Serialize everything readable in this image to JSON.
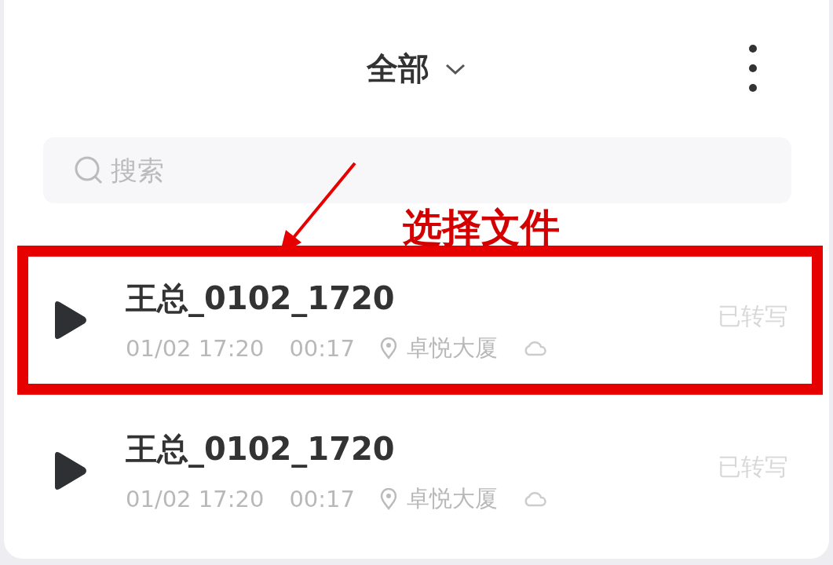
{
  "header": {
    "title": "全部"
  },
  "search": {
    "placeholder": "搜索"
  },
  "annotation": {
    "label": "选择文件"
  },
  "recordings": [
    {
      "title": "王总_0102_1720",
      "datetime": "01/02 17:20",
      "duration": "00:17",
      "location": "卓悦大厦",
      "status": "已转写",
      "highlighted": true
    },
    {
      "title": "王总_0102_1720",
      "datetime": "01/02 17:20",
      "duration": "00:17",
      "location": "卓悦大厦",
      "status": "已转写",
      "highlighted": false
    }
  ]
}
